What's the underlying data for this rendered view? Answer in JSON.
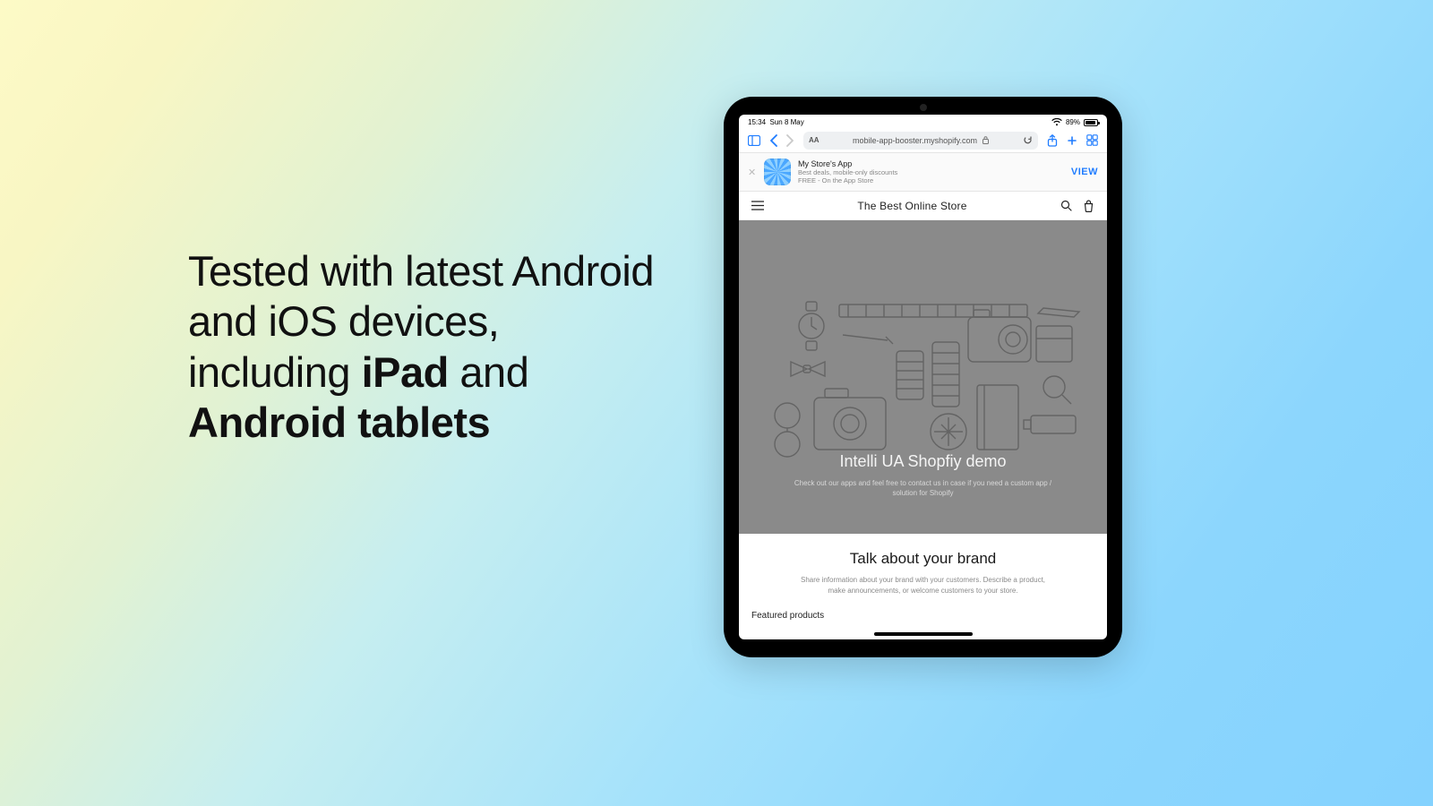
{
  "marketing": {
    "headline_pre": "Tested with latest Android and iOS devices, including ",
    "headline_b1": "iPad",
    "headline_mid": " and ",
    "headline_b2": "Android tablets"
  },
  "status": {
    "time": "15:34",
    "date": "Sun 8 May",
    "battery_pct": "89%"
  },
  "safari": {
    "aa": "AA",
    "url": "mobile-app-booster.myshopify.com"
  },
  "banner": {
    "title": "My Store's App",
    "line1": "Best deals, mobile-only discounts",
    "line2": "FREE - On the App Store",
    "cta": "VIEW"
  },
  "store": {
    "title": "The Best Online Store"
  },
  "hero": {
    "title": "Intelli UA Shopfiy demo",
    "subtitle": "Check out our apps and feel free to contact us in case if you need a custom app / solution for Shopify"
  },
  "brand": {
    "title": "Talk about your brand",
    "body": "Share information about your brand with your customers. Describe a product, make announcements, or welcome customers to your store."
  },
  "featured": {
    "heading": "Featured products"
  }
}
